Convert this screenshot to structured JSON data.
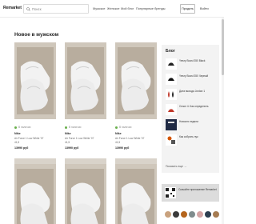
{
  "header": {
    "logo": "Remarket",
    "search": {
      "placeholder": "Поиск",
      "value": ""
    },
    "nav": [
      "Мужское",
      "Женское",
      "Мой блог",
      "Популярные бренды"
    ],
    "sell_label": "Продать",
    "login_label": "Войти"
  },
  "page_title": "Новое в мужском",
  "products": [
    {
      "status": "В наличии",
      "brand": "Nike",
      "model": "Air Force 1 Low White '07",
      "size": "41,5",
      "price": "13990 руб"
    },
    {
      "status": "В наличии",
      "brand": "Nike",
      "model": "Air Force 1 Low White '07",
      "size": "41,5",
      "price": "13990 руб"
    },
    {
      "status": "В наличии",
      "brand": "Nike",
      "model": "Air Force 1 Low White '07",
      "size": "41,5",
      "price": "13990 руб"
    }
  ],
  "blog": {
    "title": "Блог",
    "items": [
      {
        "text": "Yeezy Boost 350 Black",
        "icon": "sneaker-thumb"
      },
      {
        "text": "Yeezy Boost 350 Черный",
        "icon": "sneaker-thumb"
      },
      {
        "text": "Дата выхода Jordan 1",
        "icon": "drops-thumb"
      },
      {
        "text": "Сезон 4. Как определить",
        "icon": "sneaker-thumb"
      },
      {
        "text": "Новости недели",
        "icon": "magazine-thumb"
      },
      {
        "text": "Как собрать лук",
        "icon": "collage-thumb"
      }
    ],
    "more_label": "Показать еще →"
  },
  "promo": {
    "text": "Скачайте приложение Remarket"
  },
  "colors": {
    "accent": "#6ab04c",
    "sidebar_bg": "#f3f3f3",
    "card_bg": "#d9d3ca"
  }
}
